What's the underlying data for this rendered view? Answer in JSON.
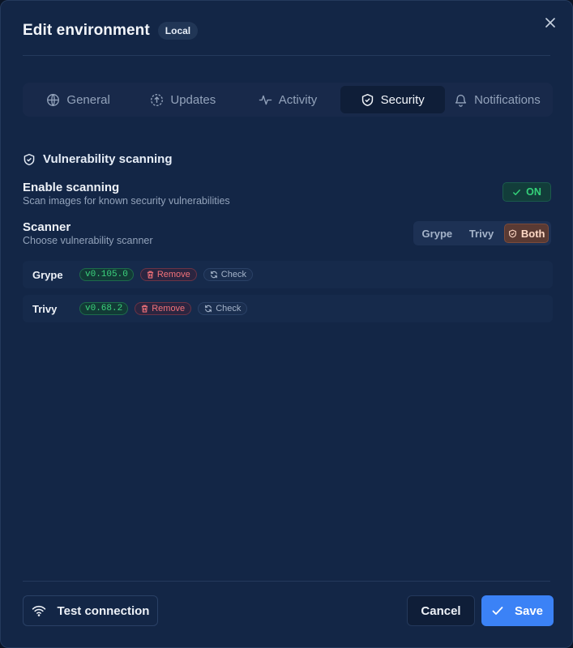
{
  "dialog": {
    "title": "Edit environment",
    "badge": "Local",
    "close_icon": "close-icon"
  },
  "tabs": [
    {
      "label": "General",
      "icon": "globe-icon",
      "active": false
    },
    {
      "label": "Updates",
      "icon": "upload-circle-icon",
      "active": false
    },
    {
      "label": "Activity",
      "icon": "activity-icon",
      "active": false
    },
    {
      "label": "Security",
      "icon": "shield-check-icon",
      "active": true
    },
    {
      "label": "Notifications",
      "icon": "bell-icon",
      "active": false
    }
  ],
  "security": {
    "section_title": "Vulnerability scanning",
    "enable": {
      "label": "Enable scanning",
      "description": "Scan images for known security vulnerabilities",
      "toggle_label": "ON",
      "enabled": true
    },
    "scanner": {
      "label": "Scanner",
      "description": "Choose vulnerability scanner",
      "options": [
        "Grype",
        "Trivy",
        "Both"
      ],
      "selected": "Both"
    },
    "scanners": [
      {
        "name": "Grype",
        "version": "v0.105.0",
        "remove_label": "Remove",
        "check_label": "Check"
      },
      {
        "name": "Trivy",
        "version": "v0.68.2",
        "remove_label": "Remove",
        "check_label": "Check"
      }
    ]
  },
  "footer": {
    "test_label": "Test connection",
    "cancel_label": "Cancel",
    "save_label": "Save"
  },
  "colors": {
    "background": "#132646",
    "accent": "#3b82f6",
    "success": "#34d27a",
    "danger": "#f2727a",
    "scanner_active": "#5a3a33"
  }
}
